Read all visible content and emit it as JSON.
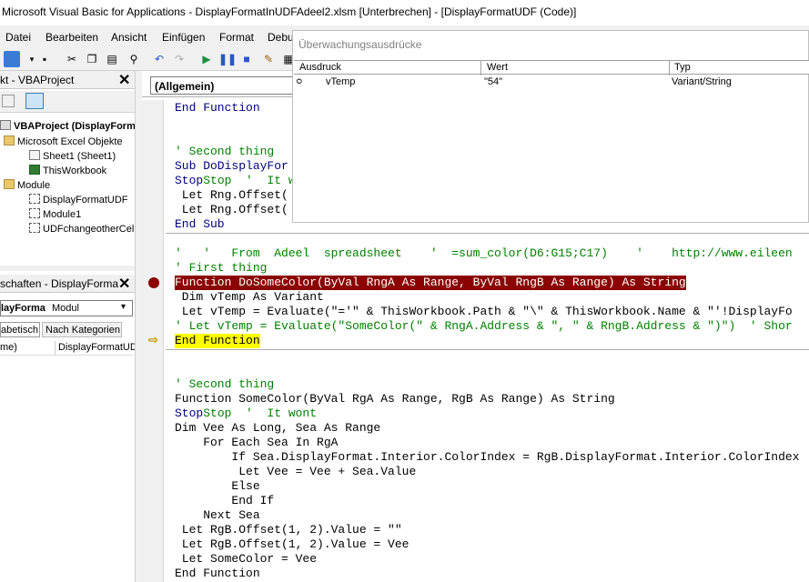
{
  "window": {
    "title": "Microsoft Visual Basic for Applications - DisplayFormatInUDFAdeel2.xlsm [Unterbrechen] - [DisplayFormatUDF (Code)]"
  },
  "menu": [
    "Datei",
    "Bearbeiten",
    "Ansicht",
    "Einfügen",
    "Format",
    "Debu"
  ],
  "toolbar_icons": [
    "excel-icon",
    "save-icon",
    "cut-icon",
    "copy-icon",
    "paste-icon",
    "find-icon",
    "undo-icon",
    "redo-icon",
    "run-icon",
    "break-icon",
    "reset-icon",
    "design-icon",
    "project-explorer-icon"
  ],
  "project": {
    "header": "kt - VBAProject",
    "root": "VBAProject (DisplayForma",
    "folder_excel": "Microsoft Excel Objekte",
    "sheet1": "Sheet1 (Sheet1)",
    "thisworkbook": "ThisWorkbook",
    "folder_module": "Module",
    "mod1": "DisplayFormatUDF",
    "mod2": "Module1",
    "mod3": "UDFchangeotherCell"
  },
  "properties": {
    "header": "schaften - DisplayForma",
    "object_name": "layForma",
    "object_type": "Modul",
    "tab_alpha": "abetisch",
    "tab_cat": "Nach Kategorien",
    "prop_name": "me)",
    "prop_value": "DisplayFormatUD"
  },
  "code_window": {
    "combo": "(Allgemein)"
  },
  "code": {
    "l1": "End Function",
    "l2": "' Second thing",
    "l3": "Sub DoDisplayFor",
    "l4": "Stop  '  It wont",
    "l5": " Let Rng.Offset(",
    "l6": " Let Rng.Offset(",
    "l7": "End Sub",
    "l8": "'   '   From  Adeel  spreadsheet    '  =sum_color(D6:G15;C17)    '    http://www.eileen",
    "l9": "' First thing",
    "l10": "Function DoSomeColor(ByVal RngA As Range, ByVal RngB As Range) As String",
    "l11": " Dim vTemp As Variant",
    "l12": " Let vTemp = Evaluate(\"='\" & ThisWorkbook.Path & \"\\\" & ThisWorkbook.Name & \"'!DisplayFo",
    "l13": "' Let vTemp = Evaluate(\"SomeColor(\" & RngA.Address & \", \" & RngB.Address & \")\")  ' Shor",
    "l14": "End Function",
    "l15": "' Second thing",
    "l16": "Function SomeColor(ByVal RgA As Range, RgB As Range) As String",
    "l17": "Stop  '  It wont",
    "l18": "Dim Vee As Long, Sea As Range",
    "l19": "    For Each Sea In RgA",
    "l20": "        If Sea.DisplayFormat.Interior.ColorIndex = RgB.DisplayFormat.Interior.ColorIndex",
    "l21": "         Let Vee = Vee + Sea.Value",
    "l22": "        Else",
    "l23": "        End If",
    "l24": "    Next Sea",
    "l25": " Let RgB.Offset(1, 2).Value = \"\"",
    "l26": " Let RgB.Offset(1, 2).Value = Vee",
    "l27": " Let SomeColor = Vee",
    "l28": "End Function"
  },
  "watch": {
    "title": "Überwachungsausdrücke",
    "col_expr": "Ausdruck",
    "col_value": "Wert",
    "col_type": "Typ",
    "row_expr": "vTemp",
    "row_value": "\"54\"",
    "row_type": "Variant/String"
  },
  "colors": {
    "breakpoint": "#8b0000",
    "current_line": "#ffff00",
    "comment": "#008000",
    "keyword": "#00007f"
  }
}
